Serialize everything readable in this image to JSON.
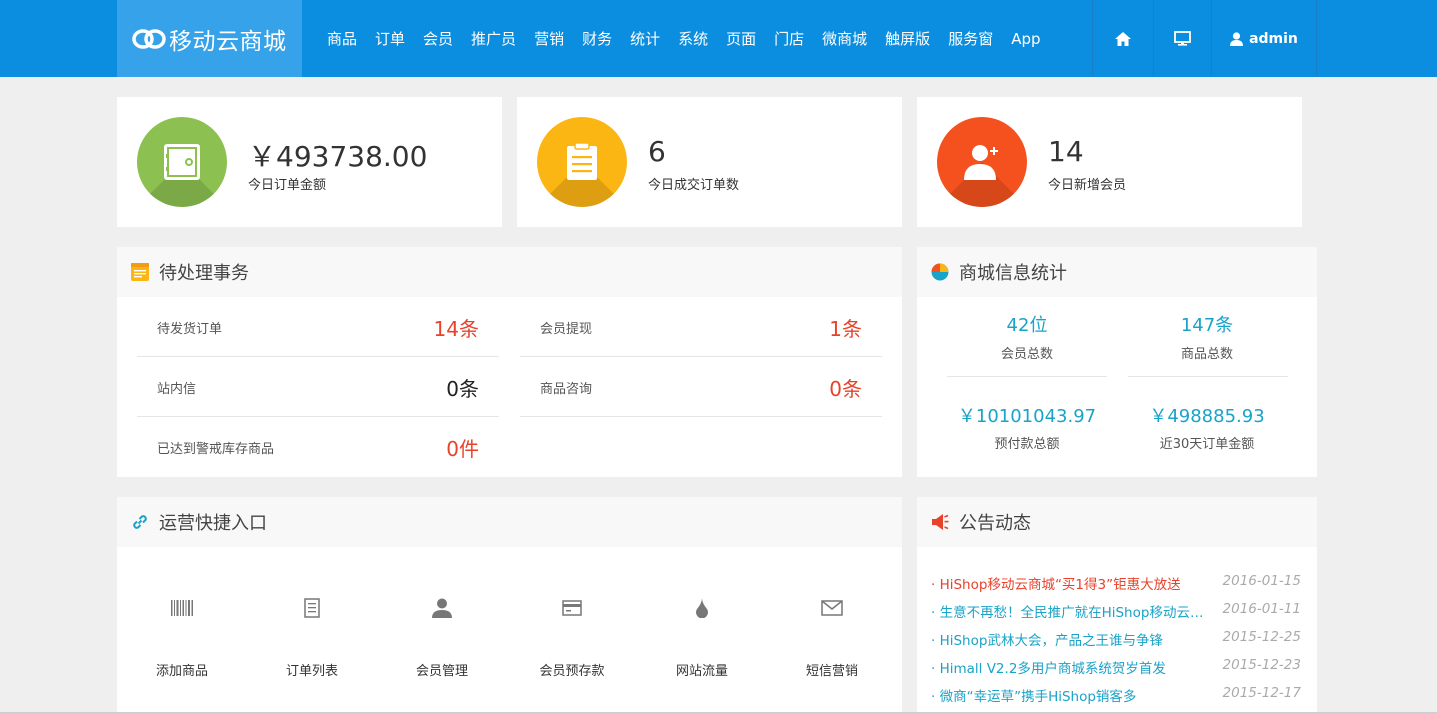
{
  "header": {
    "logo_text": "移动云商城",
    "nav": [
      "商品",
      "订单",
      "会员",
      "推广员",
      "营销",
      "财务",
      "统计",
      "系统",
      "页面",
      "门店",
      "微商城",
      "触屏版",
      "服务窗",
      "App"
    ],
    "user": "admin",
    "bg_color": "#0c8ee0"
  },
  "stats": [
    {
      "value": "￥493738.00",
      "label": "今日订单金额",
      "color": "#8cc152",
      "icon": "safe-icon"
    },
    {
      "value": "6",
      "label": "今日成交订单数",
      "color": "#fcb614",
      "icon": "clipboard-icon"
    },
    {
      "value": "14",
      "label": "今日新增会员",
      "color": "#f4511e",
      "icon": "add-user-icon"
    }
  ],
  "pending": {
    "title": "待处理事务",
    "items": [
      {
        "label": "待发货订单",
        "value": "14条",
        "color": "#e8422b"
      },
      {
        "label": "会员提现",
        "value": "1条",
        "color": "#e8422b"
      },
      {
        "label": "站内信",
        "value": "0条",
        "color": "#222222"
      },
      {
        "label": "商品咨询",
        "value": "0条",
        "color": "#e8422b"
      },
      {
        "label": "已达到警戒库存商品",
        "value": "0件",
        "color": "#e8422b"
      }
    ]
  },
  "store_stats": {
    "title": "商城信息统计",
    "items": [
      {
        "value": "42位",
        "label": "会员总数"
      },
      {
        "value": "147条",
        "label": "商品总数"
      },
      {
        "value": "￥10101043.97",
        "label": "预付款总额"
      },
      {
        "value": "￥498885.93",
        "label": "近30天订单金额"
      }
    ]
  },
  "shortcuts": {
    "title": "运营快捷入口",
    "items": [
      {
        "label": "添加商品",
        "icon": "barcode-icon"
      },
      {
        "label": "订单列表",
        "icon": "list-icon"
      },
      {
        "label": "会员管理",
        "icon": "user-icon"
      },
      {
        "label": "会员预存款",
        "icon": "card-icon"
      },
      {
        "label": "网站流量",
        "icon": "drop-icon"
      },
      {
        "label": "短信营销",
        "icon": "envelope-icon"
      }
    ]
  },
  "notices": {
    "title": "公告动态",
    "items": [
      {
        "title": "· HiShop移动云商城“买1得3”钜惠大放送",
        "date": "2016-01-15",
        "color": "#e8422b"
      },
      {
        "title": "· 生意不再愁！全民推广就在HiShop移动云商城",
        "date": "2016-01-11",
        "color": "#1aa3c8"
      },
      {
        "title": "· HiShop武林大会，产品之王谁与争锋",
        "date": "2015-12-25",
        "color": "#1aa3c8"
      },
      {
        "title": "· Himall V2.2多用户商城系统贺岁首发",
        "date": "2015-12-23",
        "color": "#1aa3c8"
      },
      {
        "title": "· 微商“幸运草”携手HiShop销客多",
        "date": "2015-12-17",
        "color": "#1aa3c8"
      }
    ]
  }
}
